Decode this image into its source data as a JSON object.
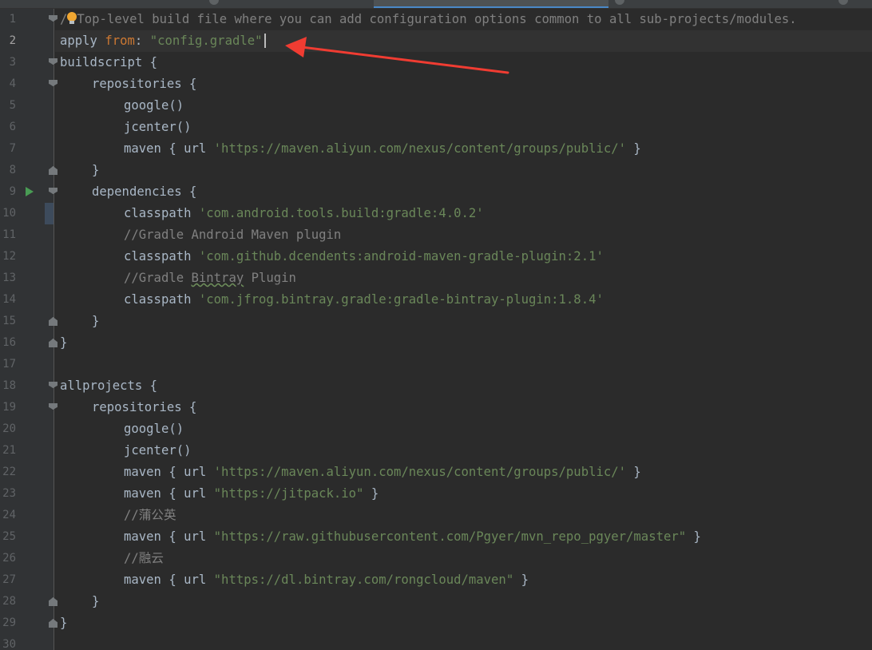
{
  "editor": {
    "current_line": 2,
    "colors": {
      "background": "#2b2b2b",
      "gutter": "#313335",
      "keyword": "#cc7832",
      "identifier": "#a9b7c6",
      "string": "#6a8759",
      "comment": "#808080",
      "line_number": "#606366",
      "annotation_arrow": "#f03c32"
    },
    "lines": [
      {
        "n": "1",
        "indent": 0,
        "fold": "open",
        "tokens": [
          [
            "cmt",
            "/"
          ],
          [
            "icon",
            "bulb"
          ],
          [
            "cmt",
            "Top-level build file where you can add configuration options common to all sub-projects/modules."
          ]
        ]
      },
      {
        "n": "2",
        "indent": 0,
        "fold": "",
        "tokens": [
          [
            "id",
            "apply "
          ],
          [
            "kw",
            "from"
          ],
          [
            "id",
            ": "
          ],
          [
            "str",
            "\"config.gradle\""
          ],
          [
            "caret",
            ""
          ]
        ]
      },
      {
        "n": "3",
        "indent": 0,
        "fold": "open",
        "tokens": [
          [
            "id",
            "buildscript {"
          ]
        ]
      },
      {
        "n": "4",
        "indent": 1,
        "fold": "open",
        "tokens": [
          [
            "id",
            "repositories {"
          ]
        ]
      },
      {
        "n": "5",
        "indent": 2,
        "fold": "",
        "tokens": [
          [
            "id",
            "google()"
          ]
        ]
      },
      {
        "n": "6",
        "indent": 2,
        "fold": "",
        "tokens": [
          [
            "id",
            "jcenter()"
          ]
        ]
      },
      {
        "n": "7",
        "indent": 2,
        "fold": "",
        "tokens": [
          [
            "id",
            "maven { url "
          ],
          [
            "str",
            "'https://maven.aliyun.com/nexus/content/groups/public/'"
          ],
          [
            "id",
            " }"
          ]
        ]
      },
      {
        "n": "8",
        "indent": 1,
        "fold": "close",
        "tokens": [
          [
            "id",
            "}"
          ]
        ]
      },
      {
        "n": "9",
        "indent": 1,
        "fold": "open",
        "run": true,
        "tokens": [
          [
            "id",
            "dependencies {"
          ]
        ]
      },
      {
        "n": "10",
        "indent": 2,
        "fold": "",
        "changed": true,
        "tokens": [
          [
            "id",
            "classpath "
          ],
          [
            "str",
            "'com.android.tools.build:gradle:4.0.2'"
          ]
        ]
      },
      {
        "n": "11",
        "indent": 2,
        "fold": "",
        "tokens": [
          [
            "cmt",
            "//Gradle Android Maven plugin"
          ]
        ]
      },
      {
        "n": "12",
        "indent": 2,
        "fold": "",
        "tokens": [
          [
            "id",
            "classpath "
          ],
          [
            "str",
            "'com.github.dcendents:android-maven-gradle-plugin:2.1'"
          ]
        ]
      },
      {
        "n": "13",
        "indent": 2,
        "fold": "",
        "tokens": [
          [
            "cmt",
            "//Gradle "
          ],
          [
            "cmtmark",
            "Bintray"
          ],
          [
            "cmt",
            " Plugin"
          ]
        ]
      },
      {
        "n": "14",
        "indent": 2,
        "fold": "",
        "tokens": [
          [
            "id",
            "classpath "
          ],
          [
            "str",
            "'com.jfrog.bintray.gradle:gradle-bintray-plugin:1.8.4'"
          ]
        ]
      },
      {
        "n": "15",
        "indent": 1,
        "fold": "close",
        "tokens": [
          [
            "id",
            "}"
          ]
        ]
      },
      {
        "n": "16",
        "indent": 0,
        "fold": "close",
        "tokens": [
          [
            "id",
            "}"
          ]
        ]
      },
      {
        "n": "17",
        "indent": 0,
        "fold": "",
        "tokens": []
      },
      {
        "n": "18",
        "indent": 0,
        "fold": "open",
        "tokens": [
          [
            "id",
            "allprojects {"
          ]
        ]
      },
      {
        "n": "19",
        "indent": 1,
        "fold": "open",
        "tokens": [
          [
            "id",
            "repositories {"
          ]
        ]
      },
      {
        "n": "20",
        "indent": 2,
        "fold": "",
        "tokens": [
          [
            "id",
            "google()"
          ]
        ]
      },
      {
        "n": "21",
        "indent": 2,
        "fold": "",
        "tokens": [
          [
            "id",
            "jcenter()"
          ]
        ]
      },
      {
        "n": "22",
        "indent": 2,
        "fold": "",
        "tokens": [
          [
            "id",
            "maven { url "
          ],
          [
            "str",
            "'https://maven.aliyun.com/nexus/content/groups/public/'"
          ],
          [
            "id",
            " }"
          ]
        ]
      },
      {
        "n": "23",
        "indent": 2,
        "fold": "",
        "tokens": [
          [
            "id",
            "maven { url "
          ],
          [
            "str",
            "\"https://jitpack.io\""
          ],
          [
            "id",
            " }"
          ]
        ]
      },
      {
        "n": "24",
        "indent": 2,
        "fold": "",
        "tokens": [
          [
            "cmt",
            "//蒲公英"
          ]
        ]
      },
      {
        "n": "25",
        "indent": 2,
        "fold": "",
        "tokens": [
          [
            "id",
            "maven { url "
          ],
          [
            "str",
            "\"https://raw.githubusercontent.com/Pgyer/mvn_repo_pgyer/master\""
          ],
          [
            "id",
            " }"
          ]
        ]
      },
      {
        "n": "26",
        "indent": 2,
        "fold": "",
        "tokens": [
          [
            "cmt",
            "//融云"
          ]
        ]
      },
      {
        "n": "27",
        "indent": 2,
        "fold": "",
        "tokens": [
          [
            "id",
            "maven { url "
          ],
          [
            "str",
            "\"https://dl.bintray.com/rongcloud/maven\""
          ],
          [
            "id",
            " }"
          ]
        ]
      },
      {
        "n": "28",
        "indent": 1,
        "fold": "close",
        "tokens": [
          [
            "id",
            "}"
          ]
        ]
      },
      {
        "n": "29",
        "indent": 0,
        "fold": "close",
        "tokens": [
          [
            "id",
            "}"
          ]
        ]
      },
      {
        "n": "30",
        "indent": 0,
        "fold": "",
        "tokens": []
      }
    ]
  }
}
